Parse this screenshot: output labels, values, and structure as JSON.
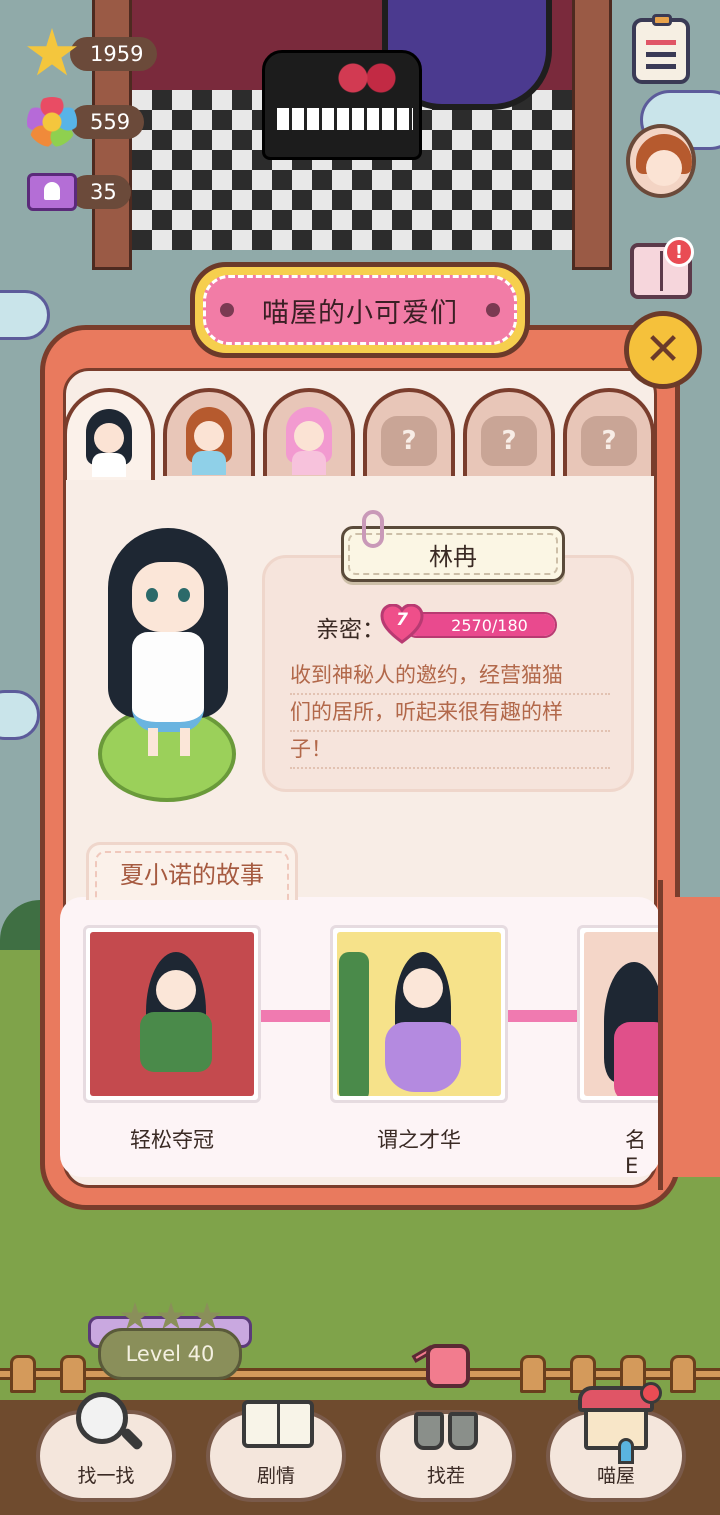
{
  "hud": {
    "stars": "1959",
    "flowers": "559",
    "tickets": "35",
    "star_icon": "star-icon",
    "flower_icon": "flower-icon",
    "ticket_icon": "ticket-icon"
  },
  "side_buttons": {
    "alert_mark": "!"
  },
  "modal": {
    "title": "喵屋的小可爱们",
    "close_glyph": "✕",
    "tabs": [
      {
        "state": "unlocked",
        "character": "林冉",
        "selected": true
      },
      {
        "state": "unlocked",
        "character": "character-2"
      },
      {
        "state": "unlocked",
        "character": "character-3"
      },
      {
        "state": "locked",
        "mark": "?"
      },
      {
        "state": "locked",
        "mark": "?"
      },
      {
        "state": "locked",
        "mark": "?"
      }
    ],
    "character": {
      "name": "林冉",
      "intimacy_label": "亲密：",
      "intimacy_level": "7",
      "intimacy_progress": "2570/180",
      "intimacy_fill_fraction": 1.0,
      "description_lines": [
        "收到神秘人的邀约，经营猫猫",
        "们的居所，听起来很有趣的样",
        "子！"
      ]
    },
    "story": {
      "heading": "夏小诺的故事",
      "chapters": [
        {
          "title": "轻松夺冠"
        },
        {
          "title": "谓之才华"
        },
        {
          "title": "名E"
        }
      ]
    }
  },
  "level": {
    "label": "Level 40",
    "stars": 3
  },
  "nav": {
    "find": "找一找",
    "story": "剧情",
    "spot": "找茬",
    "house": "喵屋"
  },
  "colors": {
    "panel": "#e97a5e",
    "banner_pink": "#f27ca6",
    "banner_gold": "#f6cf4e",
    "intimacy_pink": "#e94a8e",
    "connector": "#f07ab0"
  }
}
